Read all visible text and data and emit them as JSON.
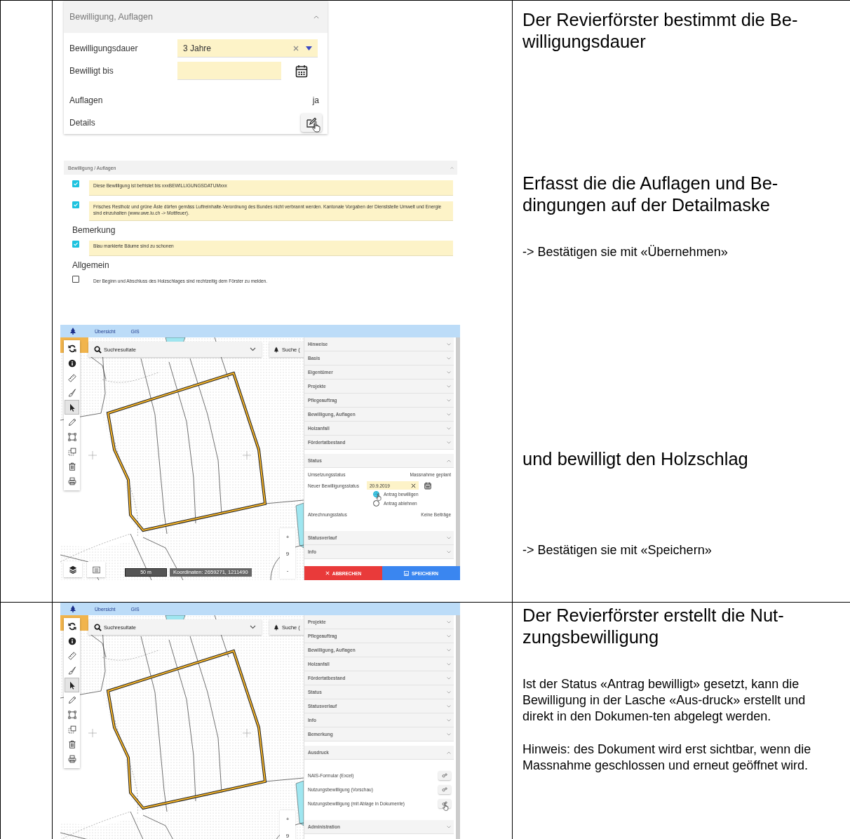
{
  "rows": [
    {
      "steps": [
        {
          "kind": "form",
          "title": "Bewilligung, Auflagen",
          "expanded": true,
          "fields": [
            {
              "kind": "select",
              "label": "Bewilligungsdauer",
              "value": "3 Jahre"
            },
            {
              "kind": "date",
              "label": "Bewilligt bis"
            },
            {
              "kind": "text",
              "label": "Auflagen",
              "value": "ja"
            },
            {
              "kind": "edit",
              "label": "Details",
              "pointer": true
            }
          ]
        },
        {
          "kind": "conditions",
          "title": "Bewilligung / Auflagen",
          "expanded": true,
          "groups": [
            {
              "items": [
                {
                  "checked": true,
                  "text": "Diese Bewilligung ist befristet bis xxxBEWILLIGUNGSDATUMxxx"
                },
                {
                  "checked": true,
                  "text": "Frisches Restholz und grüne Äste dürfen gemäss Luftreinhalte-Verordnung des Bundes nicht verbrannt werden. Kantonale Vorgaben der Dienststelle Umwelt und Energie sind einzuhalten (www.uwe.lu.ch -> Mottfeuer)."
                }
              ]
            },
            {
              "heading": "Bemerkung",
              "items": [
                {
                  "checked": true,
                  "text": "Blau markierte Bäume sind zu schonen"
                }
              ]
            },
            {
              "heading": "Allgemein",
              "items": [
                {
                  "checked": false,
                  "text": "Der Beginn und Abschluss des Holzschlages sind rechtzeitig dem Förster zu melden."
                }
              ]
            }
          ]
        },
        {
          "kind": "map_app",
          "nav": [
            "Übersicht",
            "GIS"
          ],
          "search": "Suchresultate",
          "search2": "Suche (",
          "toolbar": [
            {
              "kind": "refresh",
              "selected": false
            },
            {
              "kind": "info",
              "selected": false
            },
            {
              "kind": "ruler",
              "selected": false
            },
            {
              "kind": "brush",
              "selected": false
            },
            {
              "kind": "pointer",
              "selected": true
            },
            {
              "kind": "pencil",
              "selected": false
            },
            {
              "kind": "box",
              "selected": false
            },
            {
              "kind": "copy",
              "selected": false
            },
            {
              "kind": "trash",
              "selected": false
            },
            {
              "kind": "print",
              "selected": false
            }
          ],
          "zoom": [
            "+",
            "9",
            "-"
          ],
          "bottom_bar": {
            "scale": "50 m",
            "coordinates": "Koordinaten: 2659271, 1211490"
          },
          "sections": [
            {
              "kind": "plain",
              "title": "Hinweise",
              "expanded": false
            },
            {
              "kind": "plain",
              "title": "Basis",
              "expanded": false
            },
            {
              "kind": "plain",
              "title": "Eigentümer",
              "expanded": false
            },
            {
              "kind": "plain",
              "title": "Projekte",
              "expanded": false
            },
            {
              "kind": "plain",
              "title": "Pflegeauftrag",
              "expanded": false
            },
            {
              "kind": "plain",
              "title": "Bewilligung, Auflagen",
              "expanded": false
            },
            {
              "kind": "plain",
              "title": "Holzanfall",
              "expanded": false
            },
            {
              "kind": "plain",
              "title": "Fördertatbestand",
              "expanded": false
            },
            {
              "kind": "status",
              "title": "Status",
              "expanded": true,
              "fields": [
                {
                  "kind": "text",
                  "label": "Umsetzungsstatus",
                  "value": "Massnahme geplant"
                },
                {
                  "kind": "date",
                  "label": "Neuer Bewilligungsstatus",
                  "value": "20.9.2019",
                  "options": [
                    {
                      "label": "Antrag bewilligen",
                      "selected": true,
                      "pointer": true
                    },
                    {
                      "label": "Antrag ablehnen",
                      "selected": false,
                      "pointer": false
                    }
                  ]
                },
                {
                  "kind": "text",
                  "label": "Abrechnungsstatus",
                  "value": "Keine Beiträge"
                }
              ]
            },
            {
              "kind": "plain",
              "title": "Statusverlauf",
              "expanded": false
            },
            {
              "kind": "plain",
              "title": "Info",
              "expanded": false
            }
          ],
          "actions": [
            {
              "kind": "cancel",
              "label": "ABBRECHEN"
            },
            {
              "kind": "save",
              "label": "SPEICHERN"
            }
          ]
        }
      ],
      "notes": [
        {
          "kind": "title",
          "text": "Der Revierförster bestimmt die Be-willigungsdauer"
        },
        {
          "kind": "title",
          "text": "Erfasst die die Auflagen und Be-dingungen auf der Detailmaske"
        },
        {
          "kind": "body",
          "text": "-> Bestätigen sie mit «Übernehmen»"
        },
        {
          "kind": "title",
          "text": "und bewilligt den Holzschlag"
        },
        {
          "kind": "body",
          "text": "-> Bestätigen sie mit «Speichern»"
        }
      ]
    },
    {
      "steps": [
        {
          "kind": "map_app",
          "nav": [
            "Übersicht",
            "GIS"
          ],
          "search": "Suchresultate",
          "search2": "Suche (",
          "toolbar": [
            {
              "kind": "refresh",
              "selected": false
            },
            {
              "kind": "info",
              "selected": false
            },
            {
              "kind": "ruler",
              "selected": false
            },
            {
              "kind": "brush",
              "selected": false
            },
            {
              "kind": "pointer",
              "selected": true
            },
            {
              "kind": "pencil",
              "selected": false
            },
            {
              "kind": "box",
              "selected": false
            },
            {
              "kind": "copy",
              "selected": false
            },
            {
              "kind": "trash",
              "selected": false
            },
            {
              "kind": "print",
              "selected": false
            }
          ],
          "zoom": [
            "+",
            "9"
          ],
          "sections": [
            {
              "kind": "plain",
              "title": "Projekte",
              "expanded": false
            },
            {
              "kind": "plain",
              "title": "Pflegeauftrag",
              "expanded": false
            },
            {
              "kind": "plain",
              "title": "Bewilligung, Auflagen",
              "expanded": false
            },
            {
              "kind": "plain",
              "title": "Holzanfall",
              "expanded": false
            },
            {
              "kind": "plain",
              "title": "Fördertatbestand",
              "expanded": false
            },
            {
              "kind": "plain",
              "title": "Status",
              "expanded": false
            },
            {
              "kind": "plain",
              "title": "Statusverlauf",
              "expanded": false
            },
            {
              "kind": "plain",
              "title": "Info",
              "expanded": false
            },
            {
              "kind": "plain",
              "title": "Bemerkung",
              "expanded": false
            },
            {
              "kind": "print",
              "title": "Ausdruck",
              "expanded": true,
              "items": [
                {
                  "label": "NAIS-Formular (Excel)",
                  "pointer": false
                },
                {
                  "label": "Nutzungsbewilligung (Vorschau)",
                  "pointer": false
                },
                {
                  "label": "Nutzungsbewilligung (mit Ablage in Dokumente)",
                  "pointer": true
                }
              ]
            },
            {
              "kind": "plain",
              "title": "Administration",
              "expanded": false
            }
          ]
        }
      ],
      "notes": [
        {
          "kind": "title",
          "text": "Der Revierförster erstellt die Nut-zungsbewilligung"
        },
        {
          "kind": "body",
          "text": "Ist der Status «Antrag bewilligt» gesetzt, kann die Bewilligung in der Lasche «Aus-druck» erstellt und direkt in den Dokumen-ten abgelegt werden."
        },
        {
          "kind": "body",
          "text": "Hinweis: des Dokument wird erst sichtbar, wenn die Massnahme geschlossen und erneut geöffnet wird."
        }
      ]
    }
  ]
}
